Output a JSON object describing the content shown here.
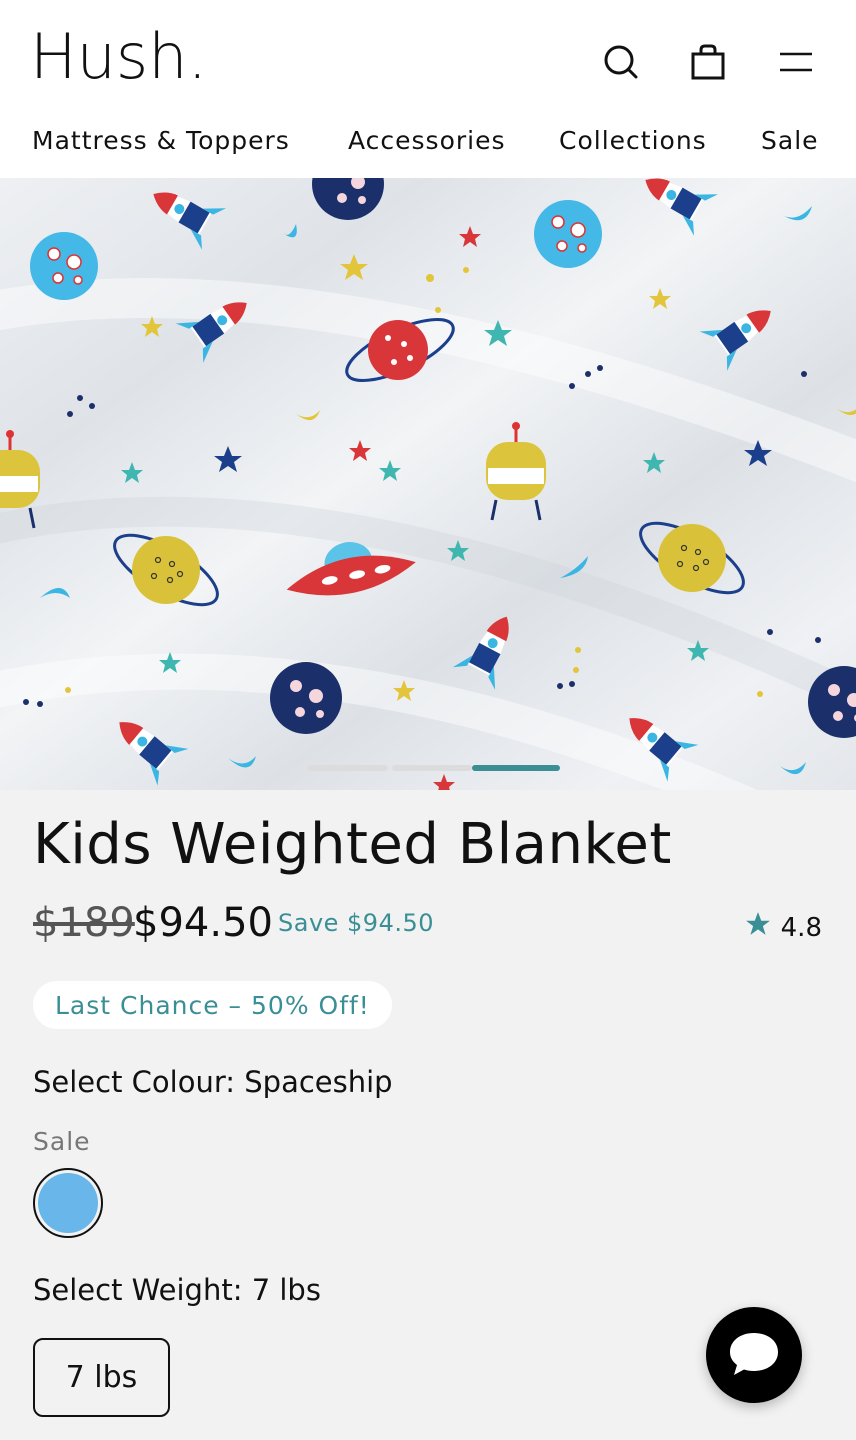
{
  "header": {
    "logo": "Hush.",
    "icons": {
      "search": "search-icon",
      "cart": "bag-icon",
      "menu": "hamburger-icon"
    }
  },
  "nav": {
    "items": [
      "Mattress & Toppers",
      "Accessories",
      "Collections",
      "Sale"
    ]
  },
  "hero": {
    "image": "space-pattern-blanket-photo",
    "carousel": {
      "total": 3,
      "active_index": 2
    }
  },
  "product": {
    "title": "Kids Weighted Blanket",
    "price_original": "$189",
    "price_current": "$94.50",
    "save_text": "Save $94.50",
    "rating": "4.8",
    "promo_badge": "Last Chance – 50% Off!",
    "colour_label": "Select Colour: Spaceship",
    "colour_group": "Sale",
    "colour_swatch": "#68b6ea",
    "weight_label": "Select Weight: 7 lbs",
    "weight_option": "7 lbs"
  },
  "colors": {
    "accent": "#3a8f95",
    "background": "#f2f2f3",
    "text": "#111111"
  },
  "chat": {
    "icon": "chat-bubble-icon"
  }
}
